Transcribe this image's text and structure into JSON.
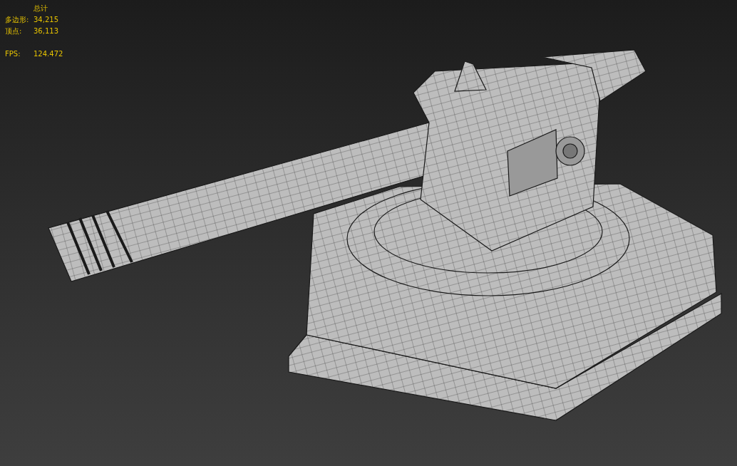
{
  "viewport_stats": {
    "header": "总计",
    "rows": [
      {
        "label": "多边形:",
        "value": "34,215"
      },
      {
        "label": "顶点:",
        "value": "36,113"
      }
    ],
    "fps": {
      "label": "FPS:",
      "value": "124.472"
    }
  }
}
